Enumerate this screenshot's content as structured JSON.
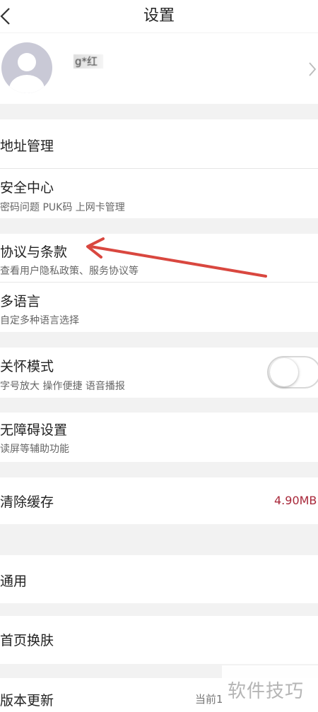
{
  "header": {
    "title": "设置",
    "back_icon": "chevron-left-icon"
  },
  "profile": {
    "username": "g*红",
    "avatar_icon": "default-avatar-icon",
    "chevron_icon": "chevron-right-icon"
  },
  "items": {
    "address": {
      "title": "地址管理"
    },
    "security": {
      "title": "安全中心",
      "subtitle": "密码问题 PUK码 上网卡管理"
    },
    "agreement": {
      "title": "协议与条款",
      "subtitle": "查看用户隐私政策、服务协议等"
    },
    "language": {
      "title": "多语言",
      "subtitle": "自定多种语言选择"
    },
    "care_mode": {
      "title": "关怀模式",
      "subtitle": "字号放大 操作便捷 语音播报",
      "enabled": false
    },
    "accessibility": {
      "title": "无障碍设置",
      "subtitle": "读屏等辅助功能"
    },
    "clear_cache": {
      "title": "清除缓存",
      "value": "4.90MB"
    },
    "general": {
      "title": "通用"
    },
    "skin": {
      "title": "首页换肤"
    },
    "update": {
      "title": "版本更新",
      "value": "当前1"
    }
  },
  "watermark": "软件技巧",
  "colors": {
    "annotation_arrow": "#d9473f",
    "cache_value": "#a8283a",
    "background": "#f2f2f2"
  }
}
